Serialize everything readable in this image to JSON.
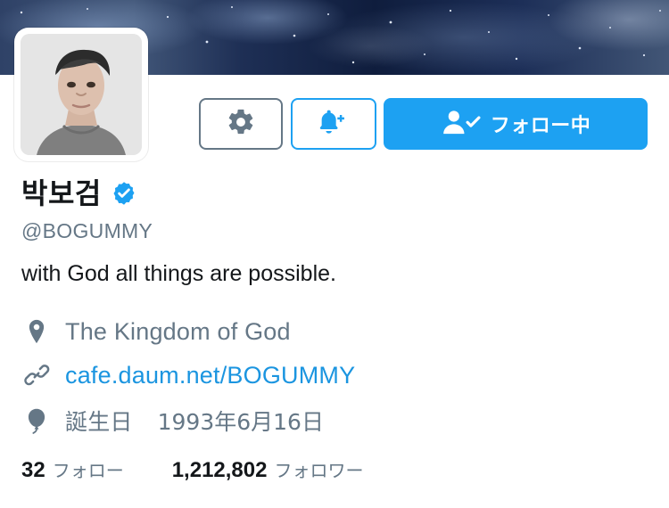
{
  "colors": {
    "accent": "#1da1f2",
    "link": "#1b95e0",
    "secondary_text": "#657786",
    "primary_text": "#14171a",
    "banner_dark": "#0f1d3d"
  },
  "header": {
    "banner_icon": "night-sky-banner",
    "avatar_icon": "profile-avatar"
  },
  "actions": {
    "settings_icon": "gear-icon",
    "notify_icon": "bell-plus-icon",
    "follow_icon": "user-check-icon",
    "follow_label": "フォロー中"
  },
  "profile": {
    "display_name": "박보검",
    "verified_icon": "verified-icon",
    "handle": "@BOGUMMY",
    "bio": "with God all things are possible.",
    "location": "The Kingdom of God",
    "url": "cafe.daum.net/BOGUMMY",
    "birthday_label": "誕生日",
    "birthday_value": "1993年6月16日",
    "location_icon": "location-pin-icon",
    "url_icon": "link-icon",
    "birthday_icon": "balloon-icon"
  },
  "stats": {
    "following_count": "32",
    "following_label": "フォロー",
    "followers_count": "1,212,802",
    "followers_label": "フォロワー"
  }
}
